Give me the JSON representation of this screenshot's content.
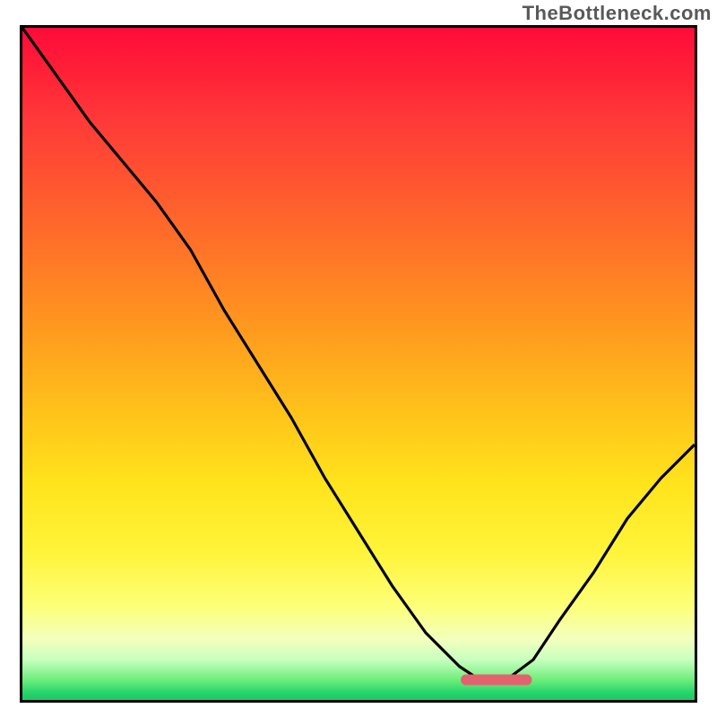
{
  "watermark": "TheBottleneck.com",
  "colors": {
    "gradient_top": "#ff0b3a",
    "gradient_bottom": "#1fc968",
    "curve": "#000000",
    "marker": "#e4616e",
    "border": "#000000"
  },
  "chart_data": {
    "type": "line",
    "title": "",
    "xlabel": "",
    "ylabel": "",
    "xlim": [
      0,
      100
    ],
    "ylim": [
      0,
      100
    ],
    "grid": false,
    "legend": false,
    "notes": "No axis ticks or labels are rendered. Background is a vertical rainbow gradient (red top → green bottom). A single black curve descends steeply from top-left, reaches a flat minimum near x≈68–73 at y≈3, then rises steeply toward the right edge. A short rounded pink/rose segment marks the flat minimum.",
    "series": [
      {
        "name": "bottleneck-curve",
        "x": [
          0,
          5,
          10,
          15,
          20,
          25,
          30,
          35,
          40,
          45,
          50,
          55,
          60,
          65,
          68,
          72,
          76,
          80,
          85,
          90,
          95,
          100
        ],
        "y": [
          100,
          93,
          86,
          80,
          74,
          67,
          58,
          50,
          42,
          33,
          25,
          17,
          10,
          5,
          3,
          3,
          6,
          12,
          19,
          27,
          33,
          38
        ]
      }
    ],
    "annotations": [
      {
        "name": "optimal-range-marker",
        "shape": "segment",
        "x_start": 66,
        "x_end": 75,
        "y": 3,
        "color": "#e4616e"
      }
    ]
  }
}
